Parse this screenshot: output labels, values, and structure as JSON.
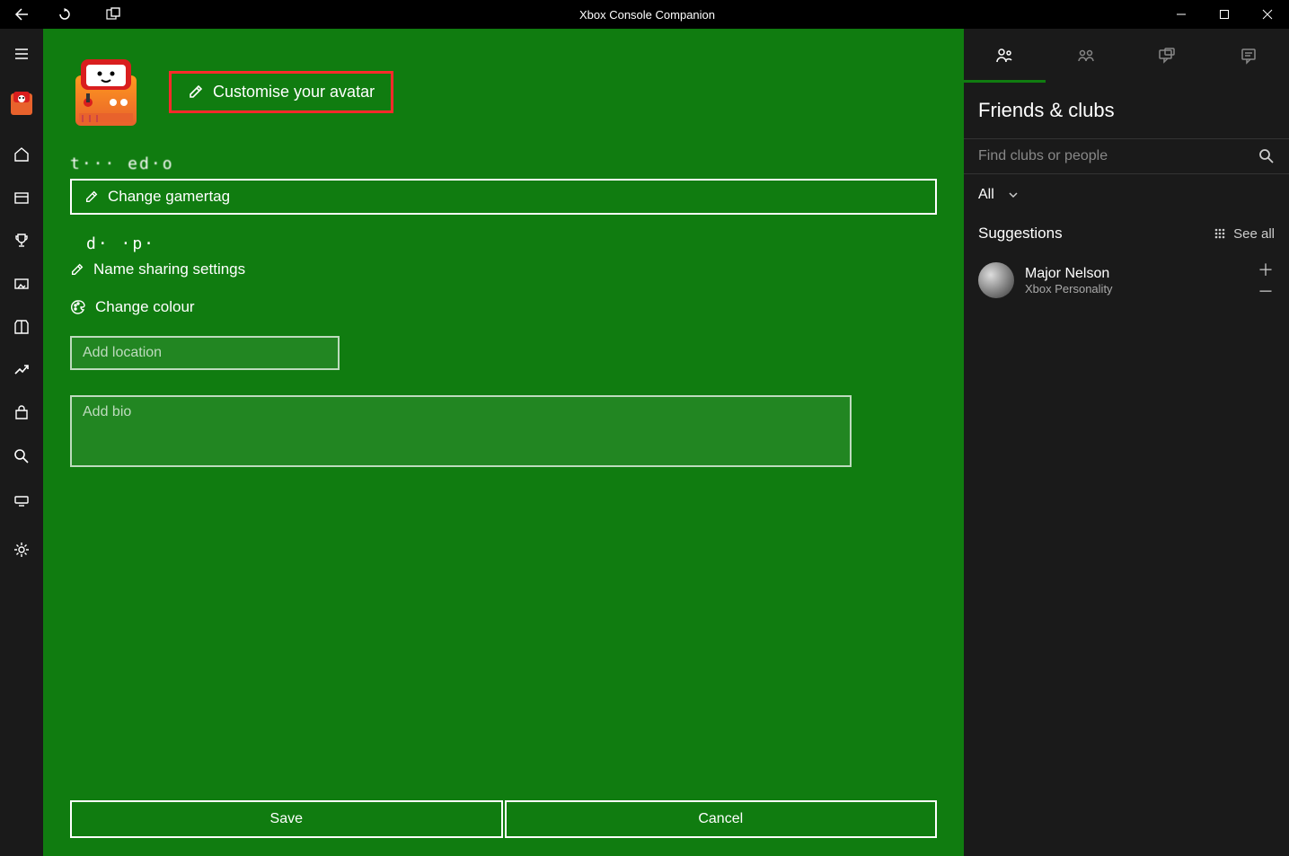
{
  "titlebar": {
    "title": "Xbox Console Companion"
  },
  "profile": {
    "customise_label": "Customise your avatar",
    "gamertag_display": "t··· ed·o",
    "change_gamertag_label": "Change gamertag",
    "realname_display": "d· ·p·",
    "name_sharing_label": "Name sharing settings",
    "change_colour_label": "Change colour",
    "location_placeholder": "Add location",
    "bio_placeholder": "Add bio",
    "save_label": "Save",
    "cancel_label": "Cancel"
  },
  "friends": {
    "heading": "Friends & clubs",
    "search_placeholder": "Find clubs or people",
    "filter_label": "All",
    "suggestions_heading": "Suggestions",
    "see_all_label": "See all",
    "suggestions": [
      {
        "name": "Major Nelson",
        "desc": "Xbox Personality"
      }
    ]
  }
}
